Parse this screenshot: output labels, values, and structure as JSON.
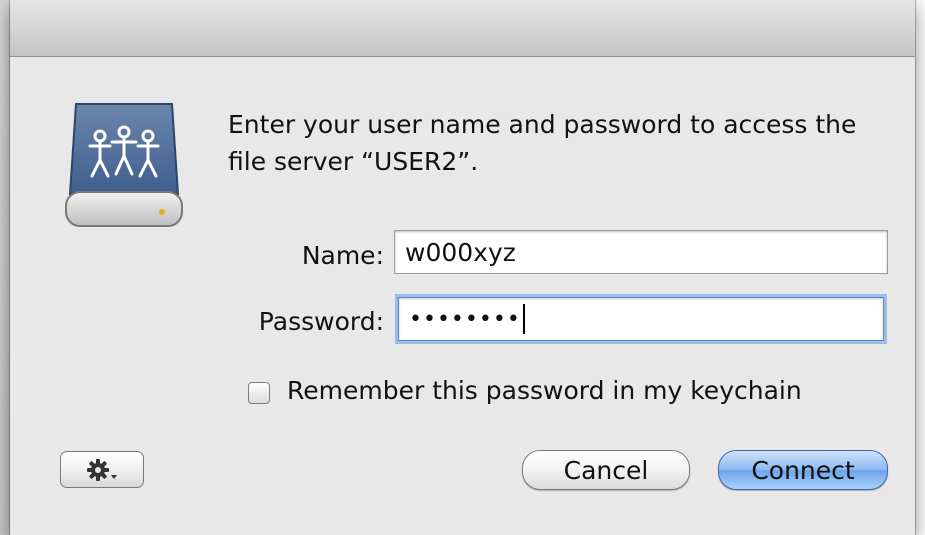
{
  "dialog": {
    "message": "Enter your user name and password to access the file server “USER2”."
  },
  "form": {
    "name_label": "Name:",
    "name_value": "w000xyz",
    "password_label": "Password:",
    "password_value": "••••••••",
    "remember_label": "Remember this password in my keychain",
    "remember_checked": false
  },
  "buttons": {
    "cancel_label": "Cancel",
    "connect_label": "Connect",
    "action_menu_icon": "gear-icon"
  },
  "icons": {
    "server": "shared-network-server-icon"
  },
  "colors": {
    "default_button": "#7fb2ee",
    "focus_ring": "#9cbde8"
  }
}
